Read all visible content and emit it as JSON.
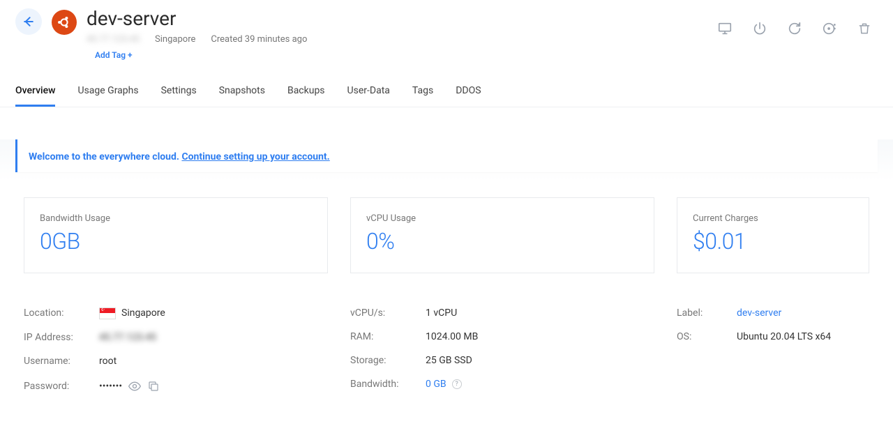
{
  "header": {
    "title": "dev-server",
    "ip_masked": "45.77.123.45",
    "region": "Singapore",
    "created": "Created 39 minutes ago",
    "add_tag": "Add Tag +"
  },
  "tabs": [
    {
      "id": "overview",
      "label": "Overview",
      "active": true
    },
    {
      "id": "usage-graphs",
      "label": "Usage Graphs"
    },
    {
      "id": "settings",
      "label": "Settings"
    },
    {
      "id": "snapshots",
      "label": "Snapshots"
    },
    {
      "id": "backups",
      "label": "Backups"
    },
    {
      "id": "user-data",
      "label": "User-Data"
    },
    {
      "id": "tags",
      "label": "Tags"
    },
    {
      "id": "ddos",
      "label": "DDOS"
    }
  ],
  "banner": {
    "prefix": "Welcome to the everywhere cloud. ",
    "link": "Continue setting up your account."
  },
  "metrics": {
    "bandwidth": {
      "label": "Bandwidth Usage",
      "value": "0GB"
    },
    "vcpu": {
      "label": "vCPU Usage",
      "value": "0%"
    },
    "charges": {
      "label": "Current Charges",
      "value": "$0.01"
    }
  },
  "details": {
    "col1": {
      "location": {
        "label": "Location:",
        "value": "Singapore"
      },
      "ip": {
        "label": "IP Address:",
        "value": "45.77.123.45"
      },
      "username": {
        "label": "Username:",
        "value": "root"
      },
      "password": {
        "label": "Password:",
        "value": "•••••••"
      }
    },
    "col2": {
      "vcpus": {
        "label": "vCPU/s:",
        "value": "1 vCPU"
      },
      "ram": {
        "label": "RAM:",
        "value": "1024.00 MB"
      },
      "storage": {
        "label": "Storage:",
        "value": "25 GB SSD"
      },
      "bandwidth": {
        "label": "Bandwidth:",
        "value": "0 GB"
      }
    },
    "col3": {
      "label_key": {
        "label": "Label:",
        "value": "dev-server"
      },
      "os": {
        "label": "OS:",
        "value": "Ubuntu 20.04 LTS x64"
      }
    }
  }
}
